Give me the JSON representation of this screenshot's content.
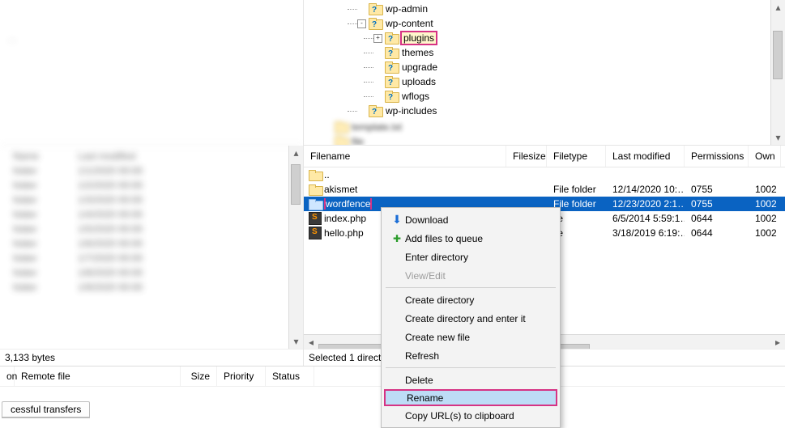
{
  "left": {
    "status": "3,133 bytes"
  },
  "right_tree": {
    "items": [
      {
        "depth": 2,
        "expander": "",
        "label": "wp-admin",
        "hl": false
      },
      {
        "depth": 2,
        "expander": "-",
        "label": "wp-content",
        "hl": false
      },
      {
        "depth": 3,
        "expander": "+",
        "label": "plugins",
        "hl": true
      },
      {
        "depth": 3,
        "expander": "",
        "label": "themes",
        "hl": false
      },
      {
        "depth": 3,
        "expander": "",
        "label": "upgrade",
        "hl": false
      },
      {
        "depth": 3,
        "expander": "",
        "label": "uploads",
        "hl": false
      },
      {
        "depth": 3,
        "expander": "",
        "label": "wflogs",
        "hl": false
      },
      {
        "depth": 2,
        "expander": "",
        "label": "wp-includes",
        "hl": false
      }
    ]
  },
  "columns": {
    "name": "Filename",
    "size": "Filesize",
    "type": "Filetype",
    "mod": "Last modified",
    "perm": "Permissions",
    "own": "Own"
  },
  "rows": [
    {
      "icon": "folder",
      "name": "..",
      "size": "",
      "type": "",
      "mod": "",
      "perm": "",
      "own": "",
      "sel": false,
      "hl": false
    },
    {
      "icon": "folder",
      "name": "akismet",
      "size": "",
      "type": "File folder",
      "mod": "12/14/2020 10:…",
      "perm": "0755",
      "own": "1002",
      "sel": false,
      "hl": false
    },
    {
      "icon": "folder",
      "name": "wordfence",
      "size": "",
      "type": "File folder",
      "mod": "12/23/2020 2:1…",
      "perm": "0755",
      "own": "1002",
      "sel": true,
      "hl": true
    },
    {
      "icon": "file",
      "name": "index.php",
      "size": "",
      "type": "ile",
      "mod": "6/5/2014 5:59:1…",
      "perm": "0644",
      "own": "1002",
      "sel": false,
      "hl": false
    },
    {
      "icon": "file",
      "name": "hello.php",
      "size": "",
      "type": "ile",
      "mod": "3/18/2019 6:19:…",
      "perm": "0644",
      "own": "1002",
      "sel": false,
      "hl": false
    }
  ],
  "right_status": "Selected 1 directo",
  "queue": {
    "col1_prefix": "on",
    "col1": "Remote file",
    "col2": "Size",
    "col3": "Priority",
    "col4": "Status",
    "tab": "cessful transfers"
  },
  "ctx": [
    {
      "type": "item",
      "icon": "download",
      "label": "Download"
    },
    {
      "type": "item",
      "icon": "queue",
      "label": "Add files to queue"
    },
    {
      "type": "item",
      "icon": "",
      "label": "Enter directory"
    },
    {
      "type": "item",
      "icon": "",
      "label": "View/Edit",
      "disabled": true
    },
    {
      "type": "sep"
    },
    {
      "type": "item",
      "icon": "",
      "label": "Create directory"
    },
    {
      "type": "item",
      "icon": "",
      "label": "Create directory and enter it"
    },
    {
      "type": "item",
      "icon": "",
      "label": "Create new file"
    },
    {
      "type": "item",
      "icon": "",
      "label": "Refresh"
    },
    {
      "type": "sep"
    },
    {
      "type": "item",
      "icon": "",
      "label": "Delete"
    },
    {
      "type": "item",
      "icon": "",
      "label": "Rename",
      "selected": true,
      "hlred": true
    },
    {
      "type": "item",
      "icon": "",
      "label": "Copy URL(s) to clipboard"
    }
  ]
}
